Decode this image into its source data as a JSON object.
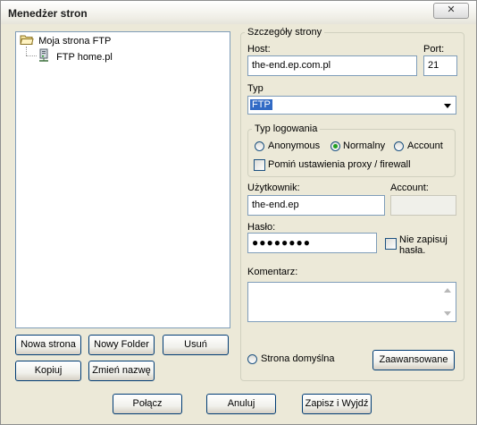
{
  "window": {
    "title": "Menedżer stron",
    "close_glyph": "✕"
  },
  "tree": {
    "root": {
      "label": "Moja strona FTP",
      "icon": "folder-open-icon"
    },
    "child": {
      "label": "FTP home.pl",
      "icon": "server-icon"
    }
  },
  "left_buttons": {
    "new_site": "Nowa strona",
    "new_folder": "Nowy Folder",
    "delete": "Usuń",
    "copy": "Kopiuj",
    "rename": "Zmień nazwę"
  },
  "details": {
    "group_title": "Szczegóły strony",
    "host_label": "Host:",
    "host_value": "the-end.ep.com.pl",
    "port_label": "Port:",
    "port_value": "21",
    "type_label": "Typ",
    "type_value": "FTP",
    "login_group_title": "Typ logowania",
    "login_options": [
      "Anonymous",
      "Normalny",
      "Account"
    ],
    "login_selected": "Normalny",
    "proxy_checkbox_label": "Pomiń ustawienia proxy / firewall",
    "user_label": "Użytkownik:",
    "user_value": "the-end.ep",
    "account_label": "Account:",
    "account_value": "",
    "password_label": "Hasło:",
    "password_value": "●●●●●●●●",
    "no_save_label_1": "Nie zapisuj",
    "no_save_label_2": "hasła.",
    "comment_label": "Komentarz:",
    "comment_value": "",
    "default_site_label": "Strona domyślna",
    "advanced_button": "Zaawansowane"
  },
  "bottom_buttons": {
    "connect": "Połącz",
    "cancel": "Anuluj",
    "save_exit": "Zapisz i Wyjdź"
  },
  "colors": {
    "selection": "#316ac5",
    "field_border": "#7f9db9",
    "radio_dot": "#21a121"
  }
}
